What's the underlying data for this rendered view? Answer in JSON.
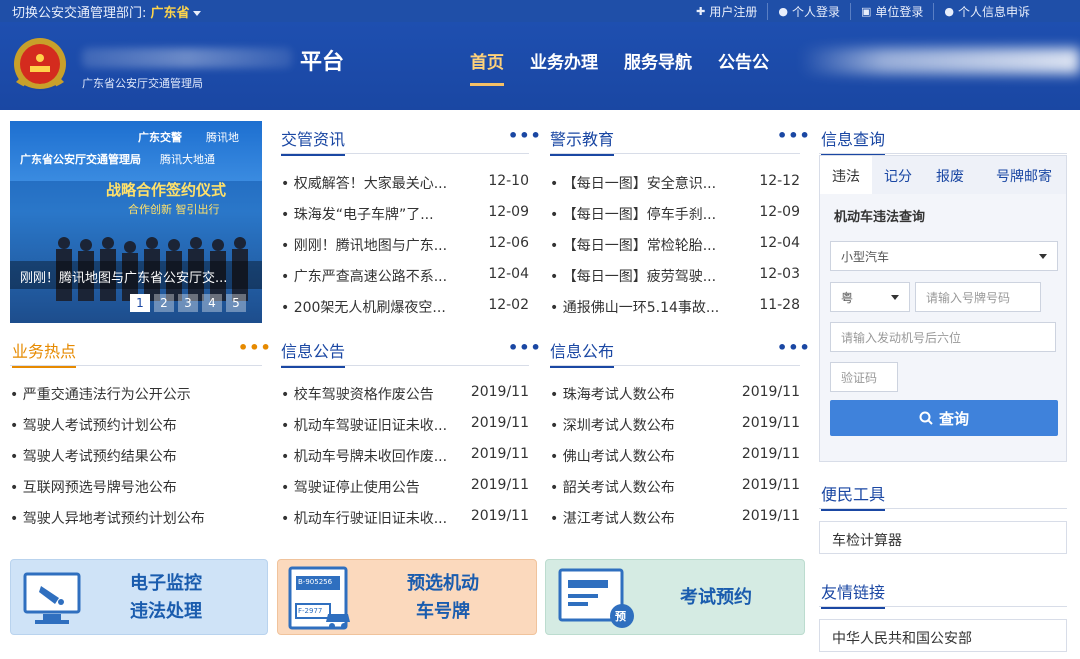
{
  "topbar": {
    "dept_prefix": "切换公安交通管理部门:",
    "dept_value": "广东省",
    "links": [
      "用户注册",
      "个人登录",
      "单位登录",
      "个人信息申诉"
    ]
  },
  "header": {
    "title": "平台",
    "subtitle": "广东省公安厅交通管理局",
    "nav": [
      "首页",
      "业务办理",
      "服务导航",
      "公告公"
    ]
  },
  "banner": {
    "line_top_left": "广东交警",
    "line_top_right": "腾讯地",
    "line_mid_left": "广东省公安厅交通管理局",
    "line_mid_right": "腾讯大地通",
    "headline": "战略合作签约仪式",
    "subhead": "合作创新  智引出行",
    "caption": "刚刚！腾讯地图与广东省公安厅交...",
    "pages": [
      "1",
      "2",
      "3",
      "4",
      "5"
    ]
  },
  "news": {
    "title": "交管资讯",
    "more": "•••",
    "items": [
      {
        "text": "• 权威解答！大家最关心...",
        "date": "12-10"
      },
      {
        "text": "• 珠海发“电子车牌”了...",
        "date": "12-09"
      },
      {
        "text": "• 刚刚！腾讯地图与广东...",
        "date": "12-06"
      },
      {
        "text": "• 广东严查高速公路不系...",
        "date": "12-04"
      },
      {
        "text": "• 200架无人机刷爆夜空...",
        "date": "12-02"
      }
    ]
  },
  "warning": {
    "title": "警示教育",
    "more": "•••",
    "items": [
      {
        "text": "• 【每日一图】安全意识...",
        "date": "12-12"
      },
      {
        "text": "• 【每日一图】停车手刹...",
        "date": "12-09"
      },
      {
        "text": "• 【每日一图】常检轮胎...",
        "date": "12-04"
      },
      {
        "text": "• 【每日一图】疲劳驾驶...",
        "date": "12-03"
      },
      {
        "text": "• 通报佛山一环5.14事故...",
        "date": "11-28"
      }
    ]
  },
  "hot": {
    "title": "业务热点",
    "more": "•••",
    "items": [
      "• 严重交通违法行为公开公示",
      "• 驾驶人考试预约计划公布",
      "• 驾驶人考试预约结果公布",
      "• 互联网预选号牌号池公布",
      "• 驾驶人异地考试预约计划公布"
    ]
  },
  "notice": {
    "title": "信息公告",
    "more": "•••",
    "items": [
      {
        "text": "• 校车驾驶资格作废公告",
        "date": "2019/11"
      },
      {
        "text": "• 机动车驾驶证旧证未收...",
        "date": "2019/11"
      },
      {
        "text": "• 机动车号牌未收回作废...",
        "date": "2019/11"
      },
      {
        "text": "• 驾驶证停止使用公告",
        "date": "2019/11"
      },
      {
        "text": "• 机动车行驶证旧证未收...",
        "date": "2019/11"
      }
    ]
  },
  "publish": {
    "title": "信息公布",
    "more": "•••",
    "items": [
      {
        "text": "• 珠海考试人数公布",
        "date": "2019/11"
      },
      {
        "text": "• 深圳考试人数公布",
        "date": "2019/11"
      },
      {
        "text": "• 佛山考试人数公布",
        "date": "2019/11"
      },
      {
        "text": "• 韶关考试人数公布",
        "date": "2019/11"
      },
      {
        "text": "• 湛江考试人数公布",
        "date": "2019/11"
      }
    ]
  },
  "query": {
    "title": "信息查询",
    "tabs": [
      "违法",
      "记分",
      "报废",
      "号牌邮寄"
    ],
    "subtitle": "机动车违法查询",
    "vehicle_type": "小型汽车",
    "province": "粤",
    "plate_placeholder": "请输入号牌号码",
    "engine_placeholder": "请输入发动机号后六位",
    "captcha_placeholder": "验证码",
    "submit": "查询"
  },
  "tools": {
    "title": "便民工具",
    "items": [
      "车检计算器"
    ]
  },
  "links": {
    "title": "友情链接",
    "items": [
      "中华人民共和国公安部"
    ]
  },
  "services": [
    {
      "line1": "电子监控",
      "line2": "违法处理",
      "color": "#cfe3f7"
    },
    {
      "line1": "预选机动",
      "line2": "车号牌",
      "color": "#fbd9bd"
    },
    {
      "line1": "考试预约",
      "line2": "",
      "color": "#d5ebe3"
    }
  ],
  "services_plate_texts": [
    "B-905256",
    "F-2977"
  ],
  "services_badge": "预",
  "colors": {
    "brand": "#1a47a3",
    "accent": "#e68a00",
    "nav_active": "#ffd27a",
    "button": "#3f82db"
  }
}
